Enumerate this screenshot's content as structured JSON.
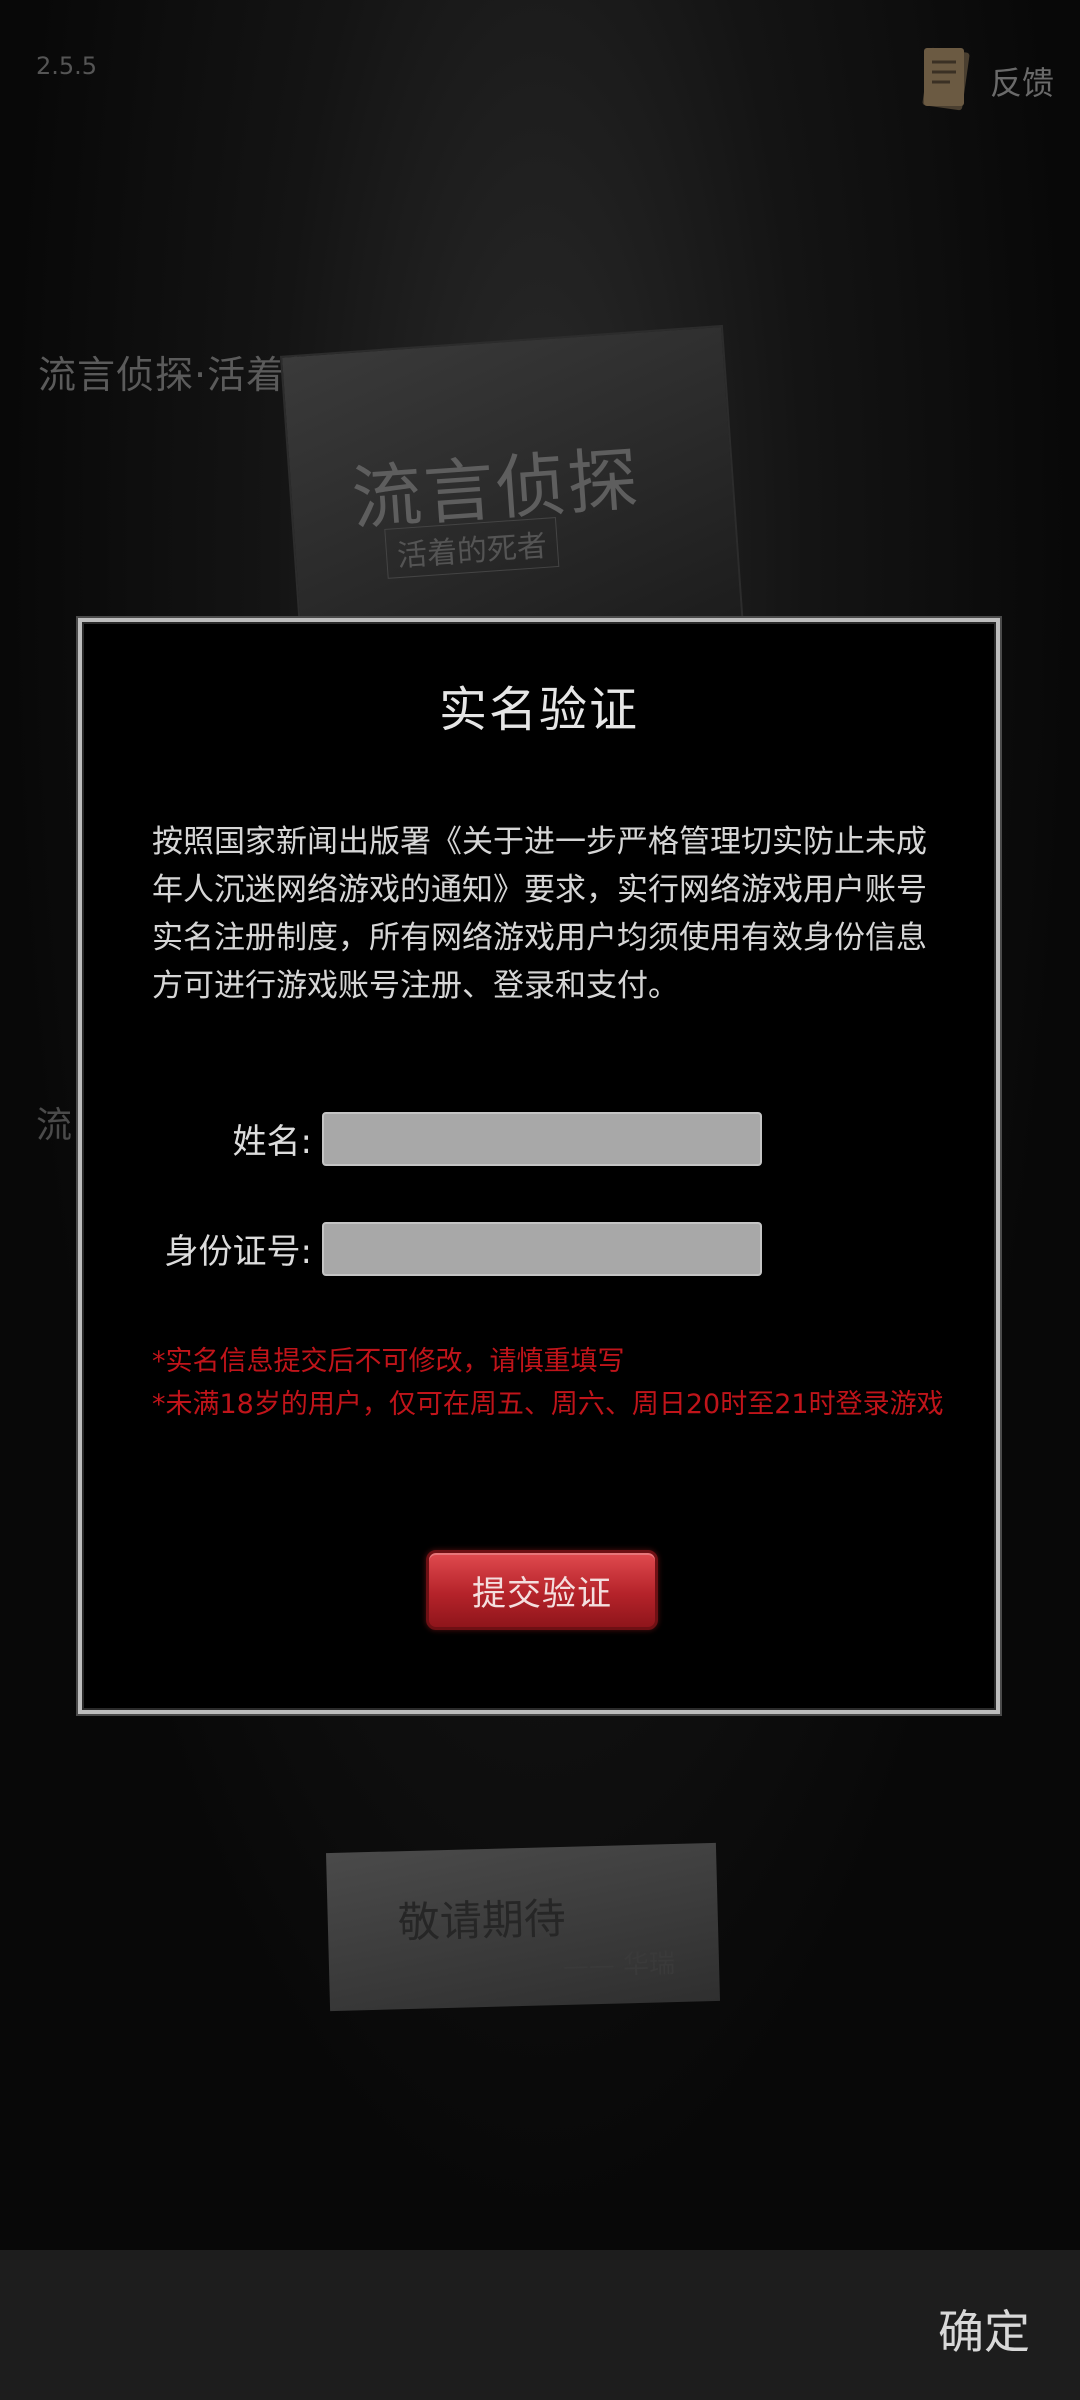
{
  "version": "2.5.5",
  "feedback": {
    "label": "反馈",
    "icon": "document-icon"
  },
  "background": {
    "title": "流言侦探·活着的死者",
    "title_partial": "流",
    "book_title": "流言侦探",
    "book_subtitle": "活着的死者",
    "card_text": "敬请期待",
    "card_sign": "—— 华瑞"
  },
  "dialog": {
    "title": "实名验证",
    "notice": "按照国家新闻出版署《关于进一步严格管理切实防止未成年人沉迷网络游戏的通知》要求，实行网络游戏用户账号实名注册制度，所有网络游戏用户均须使用有效身份信息方可进行游戏账号注册、登录和支付。",
    "name_label": "姓名:",
    "name_value": "",
    "id_label": "身份证号:",
    "id_value": "",
    "warning1": "*实名信息提交后不可修改，请慎重填写",
    "warning2": "*未满18岁的用户，仅可在周五、周六、周日20时至21时登录游戏",
    "submit_label": "提交验证"
  },
  "bottom_bar": {
    "confirm_label": "确定"
  }
}
